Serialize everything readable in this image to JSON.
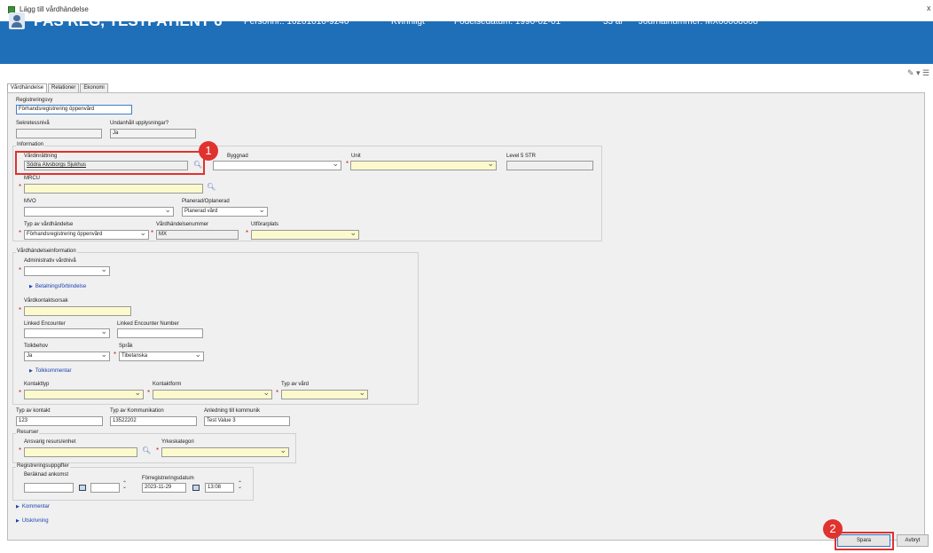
{
  "window": {
    "title": "Lägg till vårdhändelse",
    "close": "x"
  },
  "patient": {
    "name": "PAS REG, TESTPATIENT 6",
    "personnr": "Personnr.: 16201010-9240",
    "gender": "Kvinnligt",
    "birthdate": "Födelsedatum: 1990-02-01",
    "age": "33 år",
    "journal": "Journalnummer: MX00008608"
  },
  "toolbar": {
    "tools_icon": "✎ ▾ ☰"
  },
  "tabs": [
    "Vårdhändelse",
    "Relationer",
    "Ekonomi"
  ],
  "registreringsvy": {
    "label": "Registreringsvy",
    "value": "Förhandsregistrering öppenvård"
  },
  "sekretess": {
    "label": "Sekretessnivå",
    "value": ""
  },
  "undanhall": {
    "label": "Undanhåll upplysningar?",
    "value": "Ja"
  },
  "information": {
    "legend": "Information",
    "vardinrattning": {
      "label": "Vårdinrättning",
      "value": "Södra Älvsborgs Sjukhus"
    },
    "byggnad": {
      "label": "Byggnad",
      "value": ""
    },
    "unit": {
      "label": "Unit",
      "value": ""
    },
    "level5": {
      "label": "Level 5 STR",
      "value": ""
    },
    "mrcu": {
      "label": "MRCU",
      "value": ""
    },
    "mvo": {
      "label": "MVO",
      "value": ""
    },
    "planerad": {
      "label": "Planerad/Oplanerad",
      "value": "Planerad vård"
    },
    "typ_vardhandelse": {
      "label": "Typ av vårdhändelse",
      "value": "Förhandsregistrering öppenvård"
    },
    "vardhandelsenummer": {
      "label": "Vårdhändelsenummer",
      "value": "MX"
    },
    "utforarplats": {
      "label": "Utförarplats",
      "value": ""
    }
  },
  "vardhandelseinfo": {
    "legend": "Vårdhändelseinformation",
    "admin_niva": {
      "label": "Administrativ vårdnivå",
      "value": ""
    },
    "betalning_link": "Betalningsförbindelse",
    "kontaktorsak": {
      "label": "Vårdkontaktsorsak",
      "value": ""
    },
    "linked_encounter": {
      "label": "Linked Encounter",
      "value": ""
    },
    "linked_encounter_number": {
      "label": "Linked Encounter Number",
      "value": ""
    },
    "tolkbehov": {
      "label": "Tolkbehov",
      "value": "Ja"
    },
    "sprak": {
      "label": "Språk",
      "value": "Tibetanska"
    },
    "tolkkommentar_link": "Tolkkommentar",
    "kontakttyp": {
      "label": "Kontakttyp",
      "value": ""
    },
    "kontaktform": {
      "label": "Kontaktform",
      "value": ""
    },
    "typ_vard": {
      "label": "Typ av vård",
      "value": ""
    }
  },
  "kontakt": {
    "typ_kontakt": {
      "label": "Typ av kontakt",
      "value": "123"
    },
    "typ_kommunikation": {
      "label": "Typ av Kommunikation",
      "value": "13522202"
    },
    "anledning": {
      "label": "Anledning till kommunik",
      "value": "Test Value 3"
    }
  },
  "resurser": {
    "legend": "Resurser",
    "ansvarig": {
      "label": "Ansvarig resurs/enhet",
      "value": ""
    },
    "yrkeskategori": {
      "label": "Yrkeskategori",
      "value": ""
    }
  },
  "registreringsuppgifter": {
    "legend": "Registreringsuppgifter",
    "beraknad": {
      "label": "Beräknad ankomst",
      "date": "",
      "time": ""
    },
    "foregistrering": {
      "label": "Förregistreringsdatum",
      "date": "2023-11-29",
      "time": "13:08"
    }
  },
  "links": {
    "kommentar": "Kommentar",
    "utskrivning": "Utskrivning"
  },
  "buttons": {
    "spara": "Spara",
    "avbryt": "Avbryt"
  },
  "callouts": {
    "one": "1",
    "two": "2"
  },
  "colors": {
    "header_blue": "#1f6fb8",
    "required_yellow": "#fcfacd",
    "callout_red": "#e0322e"
  }
}
